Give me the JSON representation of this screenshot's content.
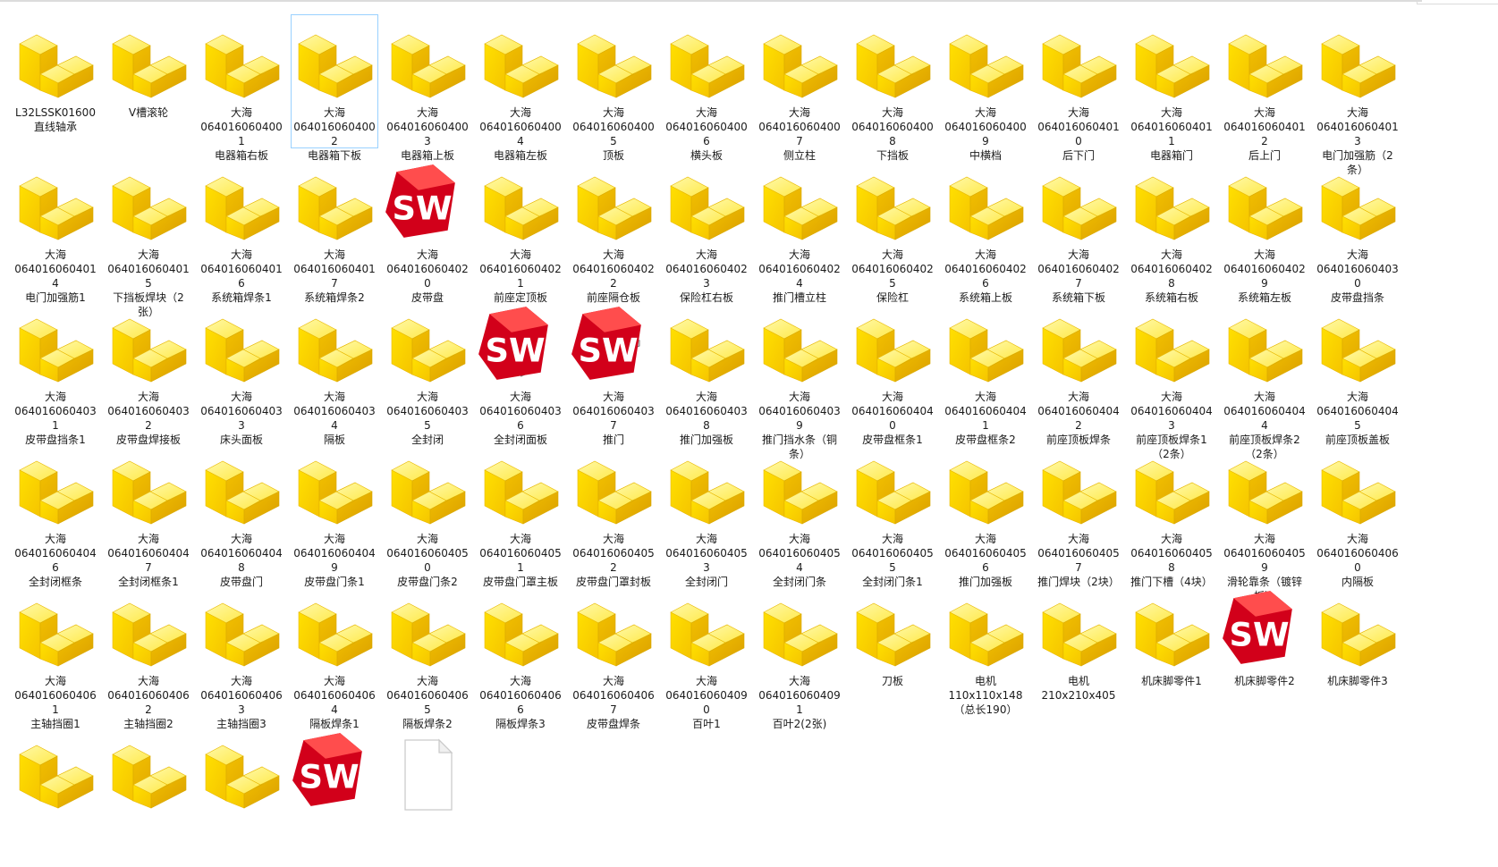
{
  "files": [
    {
      "name": "L32LSSK01600\n直线轴承",
      "icon": "part-icon"
    },
    {
      "name": "V槽滚轮",
      "icon": "part-icon"
    },
    {
      "name": "大海\n0640160604001\n电器箱右板",
      "icon": "part-icon"
    },
    {
      "name": "大海\n0640160604002\n电器箱下板",
      "icon": "part-icon",
      "selected": true
    },
    {
      "name": "大海\n0640160604003\n电器箱上板",
      "icon": "part-icon"
    },
    {
      "name": "大海\n0640160604004\n电器箱左板",
      "icon": "part-icon"
    },
    {
      "name": "大海\n0640160604005\n顶板",
      "icon": "part-icon"
    },
    {
      "name": "大海\n0640160604006\n横头板",
      "icon": "part-icon"
    },
    {
      "name": "大海\n0640160604007\n侧立柱",
      "icon": "part-icon"
    },
    {
      "name": "大海\n0640160604008\n下挡板",
      "icon": "part-icon"
    },
    {
      "name": "大海\n0640160604009\n中横档",
      "icon": "part-icon"
    },
    {
      "name": "大海\n0640160604010\n后下门",
      "icon": "part-icon"
    },
    {
      "name": "大海\n0640160604011\n电器箱门",
      "icon": "part-icon"
    },
    {
      "name": "大海\n0640160604012\n后上门",
      "icon": "part-icon"
    },
    {
      "name": "大海\n0640160604013\n电门加强筋（2条）",
      "icon": "part-icon"
    },
    {
      "name": "大海\n0640160604014\n电门加强筋1",
      "icon": "part-icon"
    },
    {
      "name": "大海\n0640160604015\n下挡板焊块（2张）",
      "icon": "part-icon"
    },
    {
      "name": "大海\n0640160604016\n系统箱焊条1",
      "icon": "part-icon"
    },
    {
      "name": "大海\n0640160604017\n系统箱焊条2",
      "icon": "part-icon"
    },
    {
      "name": "大海\n0640160604020\n皮带盘",
      "icon": "sheetmetal-preview-icon"
    },
    {
      "name": "大海\n0640160604021\n前座定顶板",
      "icon": "part-icon"
    },
    {
      "name": "大海\n0640160604022\n前座隔仓板",
      "icon": "part-icon"
    },
    {
      "name": "大海\n0640160604023\n保险杠右板",
      "icon": "part-icon"
    },
    {
      "name": "大海\n0640160604024\n推门槽立柱",
      "icon": "part-icon"
    },
    {
      "name": "大海\n0640160604025\n保险杠",
      "icon": "part-icon"
    },
    {
      "name": "大海\n0640160604026\n系统箱上板",
      "icon": "part-icon"
    },
    {
      "name": "大海\n0640160604027\n系统箱下板",
      "icon": "part-icon"
    },
    {
      "name": "大海\n0640160604028\n系统箱右板",
      "icon": "part-icon"
    },
    {
      "name": "大海\n0640160604029\n系统箱左板",
      "icon": "part-icon"
    },
    {
      "name": "大海\n0640160604030\n皮带盘挡条",
      "icon": "part-icon"
    },
    {
      "name": "大海\n0640160604031\n皮带盘挡条1",
      "icon": "part-icon"
    },
    {
      "name": "大海\n0640160604032\n皮带盘焊接板",
      "icon": "part-icon"
    },
    {
      "name": "大海\n0640160604033\n床头面板",
      "icon": "part-icon"
    },
    {
      "name": "大海\n0640160604034\n隔板",
      "icon": "part-icon"
    },
    {
      "name": "大海\n0640160604035\n全封闭",
      "icon": "part-icon"
    },
    {
      "name": "大海\n0640160604036\n全封闭面板",
      "icon": "bent-plate-preview-icon"
    },
    {
      "name": "大海\n0640160604037\n推门",
      "icon": "flat-plate-preview-icon"
    },
    {
      "name": "大海\n0640160604038\n推门加强板",
      "icon": "part-icon"
    },
    {
      "name": "大海\n0640160604039\n推门挡水条（铜条）",
      "icon": "part-icon"
    },
    {
      "name": "大海\n0640160604040\n皮带盘框条1",
      "icon": "part-icon"
    },
    {
      "name": "大海\n0640160604041\n皮带盘框条2",
      "icon": "part-icon"
    },
    {
      "name": "大海\n0640160604042\n前座顶板焊条",
      "icon": "part-icon"
    },
    {
      "name": "大海\n0640160604043\n前座顶板焊条1（2条）",
      "icon": "part-icon"
    },
    {
      "name": "大海\n0640160604044\n前座顶板焊条2（2条）",
      "icon": "part-icon"
    },
    {
      "name": "大海\n0640160604045\n前座顶板盖板",
      "icon": "part-icon"
    },
    {
      "name": "大海\n0640160604046\n全封闭框条",
      "icon": "part-icon"
    },
    {
      "name": "大海\n0640160604047\n全封闭框条1",
      "icon": "part-icon"
    },
    {
      "name": "大海\n0640160604048\n皮带盘门",
      "icon": "part-icon"
    },
    {
      "name": "大海\n0640160604049\n皮带盘门条1",
      "icon": "part-icon"
    },
    {
      "name": "大海\n0640160604050\n皮带盘门条2",
      "icon": "part-icon"
    },
    {
      "name": "大海\n0640160604051\n皮带盘门罩主板",
      "icon": "part-icon"
    },
    {
      "name": "大海\n0640160604052\n皮带盘门罩封板",
      "icon": "part-icon"
    },
    {
      "name": "大海\n0640160604053\n全封闭门",
      "icon": "part-icon"
    },
    {
      "name": "大海\n0640160604054\n全封闭门条",
      "icon": "part-icon"
    },
    {
      "name": "大海\n0640160604055\n全封闭门条1",
      "icon": "part-icon"
    },
    {
      "name": "大海\n0640160604056\n推门加强板",
      "icon": "part-icon"
    },
    {
      "name": "大海\n0640160604057\n推门焊块（2块）",
      "icon": "part-icon"
    },
    {
      "name": "大海\n0640160604058\n推门下槽（4块）",
      "icon": "part-icon"
    },
    {
      "name": "大海\n0640160604059\n滑轮靠条（镀锌板）",
      "icon": "part-icon"
    },
    {
      "name": "大海\n0640160604060\n内隔板",
      "icon": "part-icon"
    },
    {
      "name": "大海\n0640160604061\n主轴挡圈1",
      "icon": "part-icon"
    },
    {
      "name": "大海\n0640160604062\n主轴挡圈2",
      "icon": "part-icon"
    },
    {
      "name": "大海\n0640160604063\n主轴挡圈3",
      "icon": "part-icon"
    },
    {
      "name": "大海\n0640160604064\n隔板焊条1",
      "icon": "part-icon"
    },
    {
      "name": "大海\n0640160604065\n隔板焊条2",
      "icon": "part-icon"
    },
    {
      "name": "大海\n0640160604066\n隔板焊条3",
      "icon": "part-icon"
    },
    {
      "name": "大海\n0640160604067\n皮带盘焊条",
      "icon": "part-icon"
    },
    {
      "name": "大海\n0640160604090\n百叶1",
      "icon": "part-icon"
    },
    {
      "name": "大海\n0640160604091\n百叶2(2张)",
      "icon": "part-icon"
    },
    {
      "name": "刀板",
      "icon": "part-icon"
    },
    {
      "name": "电机\n110x110x148（总长190）",
      "icon": "part-icon"
    },
    {
      "name": "电机\n210x210x405",
      "icon": "part-icon"
    },
    {
      "name": "机床脚零件1",
      "icon": "part-icon"
    },
    {
      "name": "机床脚零件2",
      "icon": "assembly-preview-icon"
    },
    {
      "name": "机床脚零件3",
      "icon": "part-icon"
    },
    {
      "name": "",
      "icon": "part-icon"
    },
    {
      "name": "",
      "icon": "part-icon"
    },
    {
      "name": "",
      "icon": "part-icon"
    },
    {
      "name": "",
      "icon": "sheetmetal-preview-icon"
    },
    {
      "name": "",
      "icon": "blank-file-icon"
    }
  ]
}
